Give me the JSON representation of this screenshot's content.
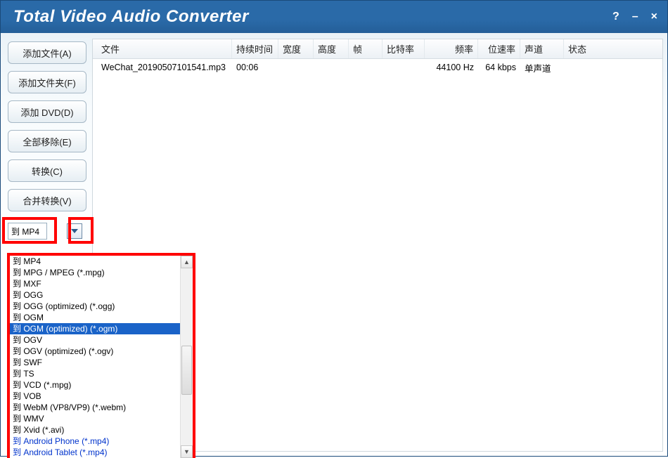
{
  "title": "Total Video Audio Converter",
  "window_controls": {
    "help": "?",
    "min": "–",
    "close": "×"
  },
  "sidebar": {
    "add_files": "添加文件(A)",
    "add_folder": "添加文件夹(F)",
    "add_dvd": "添加 DVD(D)",
    "remove_all": "全部移除(E)",
    "convert": "转换(C)",
    "merge": "合并转换(V)"
  },
  "format_selector": {
    "current": "到 MP4"
  },
  "columns": {
    "file": "文件",
    "duration": "持续时间",
    "width": "宽度",
    "height": "高度",
    "fps": "帧",
    "bitrate": "比特率",
    "frequency": "频率",
    "bits": "位速率",
    "channels": "声道",
    "status": "状态"
  },
  "rows": [
    {
      "file": "WeChat_20190507101541.mp3",
      "duration": "00:06",
      "width": "",
      "height": "",
      "fps": "",
      "bitrate": "",
      "frequency": "44100 Hz",
      "bits": "64 kbps",
      "channels": "单声道",
      "status": ""
    }
  ],
  "dropdown": {
    "selected_index": 6,
    "items": [
      {
        "t": "到 MP4"
      },
      {
        "t": "到 MPG / MPEG (*.mpg)"
      },
      {
        "t": "到 MXF"
      },
      {
        "t": "到 OGG"
      },
      {
        "t": "到 OGG (optimized) (*.ogg)"
      },
      {
        "t": "到 OGM"
      },
      {
        "t": "到 OGM (optimized) (*.ogm)"
      },
      {
        "t": "到 OGV"
      },
      {
        "t": "到 OGV (optimized) (*.ogv)"
      },
      {
        "t": "到 SWF"
      },
      {
        "t": "到 TS"
      },
      {
        "t": "到 VCD (*.mpg)"
      },
      {
        "t": "到 VOB"
      },
      {
        "t": "到 WebM (VP8/VP9) (*.webm)"
      },
      {
        "t": "到 WMV"
      },
      {
        "t": "到 Xvid (*.avi)"
      },
      {
        "t": "到 Android Phone (*.mp4)",
        "link": true
      },
      {
        "t": "到 Android Tablet (*.mp4)",
        "link": true
      }
    ]
  }
}
